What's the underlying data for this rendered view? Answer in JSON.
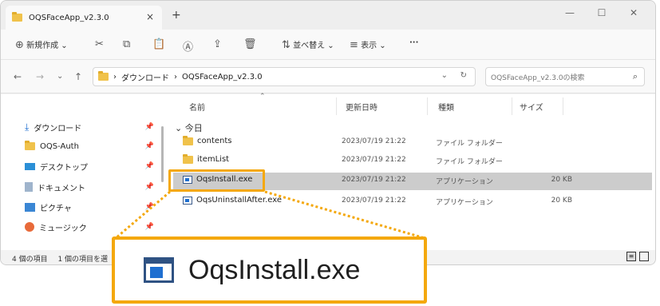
{
  "window": {
    "tab_title": "OQSFaceApp_v2.3.0",
    "tab_close": "×",
    "new_tab": "+",
    "minimize": "—",
    "maximize": "☐",
    "close": "✕"
  },
  "toolbar": {
    "new_label": "新規作成",
    "sort_label": "並べ替え",
    "view_label": "表示",
    "more_label": "···"
  },
  "address": {
    "path": [
      "ダウンロード",
      "OQSFaceApp_v2.3.0"
    ],
    "search_placeholder": "OQSFaceApp_v2.3.0の検索"
  },
  "sidebar": {
    "items": [
      {
        "label": "ダウンロード",
        "icon": "download-icon"
      },
      {
        "label": "OQS-Auth",
        "icon": "folder-icon"
      },
      {
        "label": "デスクトップ",
        "icon": "desktop-icon"
      },
      {
        "label": "ドキュメント",
        "icon": "document-icon"
      },
      {
        "label": "ピクチャ",
        "icon": "pictures-icon"
      },
      {
        "label": "ミュージック",
        "icon": "music-icon"
      }
    ]
  },
  "columns": {
    "name": "名前",
    "date": "更新日時",
    "type": "種類",
    "size": "サイズ"
  },
  "group_label": "今日",
  "files": [
    {
      "name": "contents",
      "date": "2023/07/19 21:22",
      "type": "ファイル フォルダー",
      "size": "",
      "icon": "folder-icon"
    },
    {
      "name": "itemList",
      "date": "2023/07/19 21:22",
      "type": "ファイル フォルダー",
      "size": "",
      "icon": "folder-icon"
    },
    {
      "name": "OqsInstall.exe",
      "date": "2023/07/19 21:22",
      "type": "アプリケーション",
      "size": "20 KB",
      "icon": "exe-icon"
    },
    {
      "name": "OqsUninstallAfter.exe",
      "date": "2023/07/19 21:22",
      "type": "アプリケーション",
      "size": "20 KB",
      "icon": "exe-icon"
    }
  ],
  "status": {
    "count": "4 個の項目",
    "selected": "1 個の項目を選"
  },
  "callout": {
    "text": "OqsInstall.exe"
  },
  "colors": {
    "highlight": "#f4a80d",
    "folder": "#f0c24b",
    "selected_row": "#cccccc"
  }
}
